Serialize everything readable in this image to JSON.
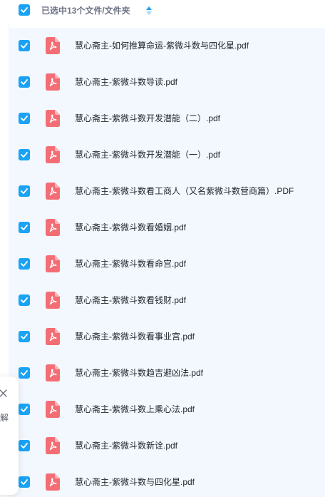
{
  "header": {
    "selection_label": "已选中13个文件/文件夹",
    "sort_icon": "sort-up-down-icon"
  },
  "colors": {
    "accent": "#1aa3f5",
    "list_bg": "#f2f8fe",
    "pdf_icon": "#f46d75",
    "text": "#1f2329",
    "muted": "#6d7385"
  },
  "files": [
    {
      "name": "慧心斋主-如何推算命运-紫微斗数与四化星.pdf",
      "checked": true,
      "icon": "pdf-file-icon"
    },
    {
      "name": "慧心斋主-紫微斗数导读.pdf",
      "checked": true,
      "icon": "pdf-file-icon"
    },
    {
      "name": "慧心斋主-紫微斗数开发潜能（二）.pdf",
      "checked": true,
      "icon": "pdf-file-icon"
    },
    {
      "name": "慧心斋主-紫微斗数开发潜能（一）.pdf",
      "checked": true,
      "icon": "pdf-file-icon"
    },
    {
      "name": "慧心斋主-紫微斗数看工商人（又名紫微斗数营商篇）.PDF",
      "checked": true,
      "icon": "pdf-file-icon"
    },
    {
      "name": "慧心斋主-紫微斗数看婚姻.pdf",
      "checked": true,
      "icon": "pdf-file-icon"
    },
    {
      "name": "慧心斋主-紫微斗数看命宫.pdf",
      "checked": true,
      "icon": "pdf-file-icon"
    },
    {
      "name": "慧心斋主-紫微斗数看钱财.pdf",
      "checked": true,
      "icon": "pdf-file-icon"
    },
    {
      "name": "慧心斋主-紫微斗数看事业宫.pdf",
      "checked": true,
      "icon": "pdf-file-icon"
    },
    {
      "name": "慧心斋主-紫微斗数趋吉避凶法.pdf",
      "checked": true,
      "icon": "pdf-file-icon"
    },
    {
      "name": "慧心斋主-紫微斗数上乘心法.pdf",
      "checked": true,
      "icon": "pdf-file-icon"
    },
    {
      "name": "慧心斋主-紫微斗数新诠.pdf",
      "checked": true,
      "icon": "pdf-file-icon"
    },
    {
      "name": "慧心斋主-紫微斗数与四化星.pdf",
      "checked": true,
      "icon": "pdf-file-icon"
    }
  ],
  "side_panel": {
    "close_icon": "close-icon",
    "text": "解"
  }
}
